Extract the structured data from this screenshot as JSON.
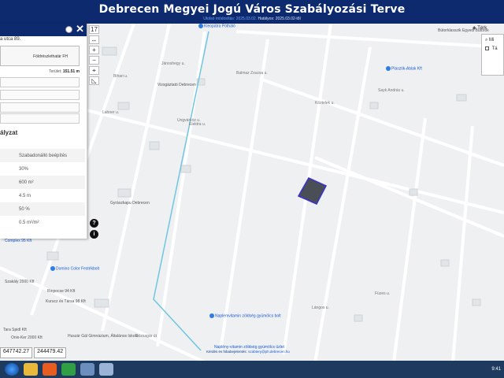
{
  "header": {
    "title": "Debrecen Megyei Jogú Város Szabályozási Terve",
    "subline_link": "Utolsó módosítás: 2025.03.02.",
    "subline_text": "Hatályos: 2025.03.02-től"
  },
  "panel": {
    "address": "a utca 89.",
    "owner_label": "Földrészlethatár FH",
    "area_label": "Terület:",
    "area_value": "151.51 m",
    "section_title": "ályzat",
    "rows": [
      {
        "value": "Szabadonálló beépítés"
      },
      {
        "value": "30%"
      },
      {
        "value": "600 m²"
      },
      {
        "value": "4.5 m"
      },
      {
        "value": "50 %"
      },
      {
        "value": "0.5 m²/m²"
      }
    ]
  },
  "toolbar": {
    "zoom_level": "17",
    "zoom_in": "+",
    "zoom_out": "−"
  },
  "right": {
    "layers_label": "Térk",
    "row1": "Mi",
    "row2": "Tá"
  },
  "coords": {
    "x": "647742.27",
    "y": "244479.42"
  },
  "footer": {
    "note_prefix": "Kérdés és hibabejelentés:",
    "note_link": "szabtery@ph.debrecen.hu"
  },
  "taskbar": {
    "clock": "9:41"
  },
  "pois": [
    {
      "label": "Kleopátra Pótháló"
    },
    {
      "label": "Plasztik-Ablak Kft"
    },
    {
      "label": "Bútorklasszik Egyedi Bútorok"
    },
    {
      "label": "Vizsgáztató Debrecen"
    },
    {
      "label": "Gyrászkapu Debrecen"
    },
    {
      "label": "Complex 95 Kft"
    },
    {
      "label": "Domino Color Festékbolt"
    },
    {
      "label": "Szakály 2000 Kft"
    },
    {
      "label": "Rinpocse 94 Kft"
    },
    {
      "label": "Kurucz és Társa 98 Kft"
    },
    {
      "label": "Tara Spidl Kft"
    },
    {
      "label": "Huszár Gál Gimnázium, Általános Iskola"
    },
    {
      "label": "Onix-Ker 2000 Kft"
    },
    {
      "label": "Naplemvitamin zöldség gyümölcs bolt"
    },
    {
      "label": "Naplény-vitamin zöldség gyümölcs üzlet"
    }
  ],
  "streets": [
    {
      "label": "Bihari u."
    },
    {
      "label": "Lahner u."
    },
    {
      "label": "Jánoshegy u."
    },
    {
      "label": "Ungvárköz u."
    },
    {
      "label": "Balmaz Zsuzsa u."
    },
    {
      "label": "Köztelek u."
    },
    {
      "label": "Sayk András u."
    },
    {
      "label": "Dózsagár út"
    },
    {
      "label": "Elektra u."
    },
    {
      "label": "Lángos u."
    },
    {
      "label": "Füzes u."
    }
  ]
}
